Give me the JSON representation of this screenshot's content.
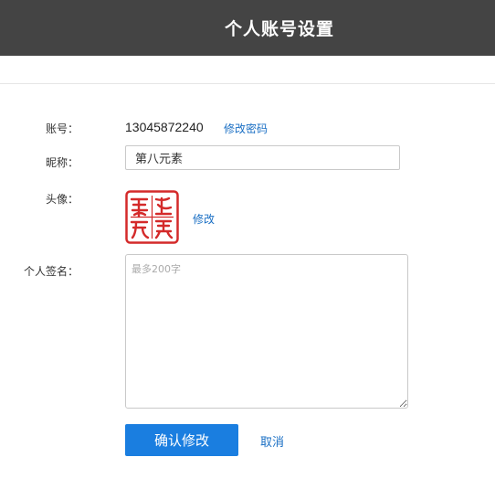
{
  "header": {
    "title": "个人账号设置"
  },
  "form": {
    "account": {
      "label": "账号：",
      "value": "13045872240",
      "change_password_link": "修改密码"
    },
    "nickname": {
      "label": "昵称：",
      "value": "第八元素"
    },
    "avatar": {
      "label": "头像：",
      "edit_link": "修改",
      "seal_text": "第八元素"
    },
    "signature": {
      "label": "个人签名：",
      "value": "",
      "placeholder": "最多200字"
    }
  },
  "actions": {
    "confirm_label": "确认修改",
    "cancel_label": "取消"
  },
  "colors": {
    "header_bg": "#444444",
    "accent": "#1a7ee0",
    "link": "#1a6fc4",
    "seal_red": "#d42a2a"
  }
}
